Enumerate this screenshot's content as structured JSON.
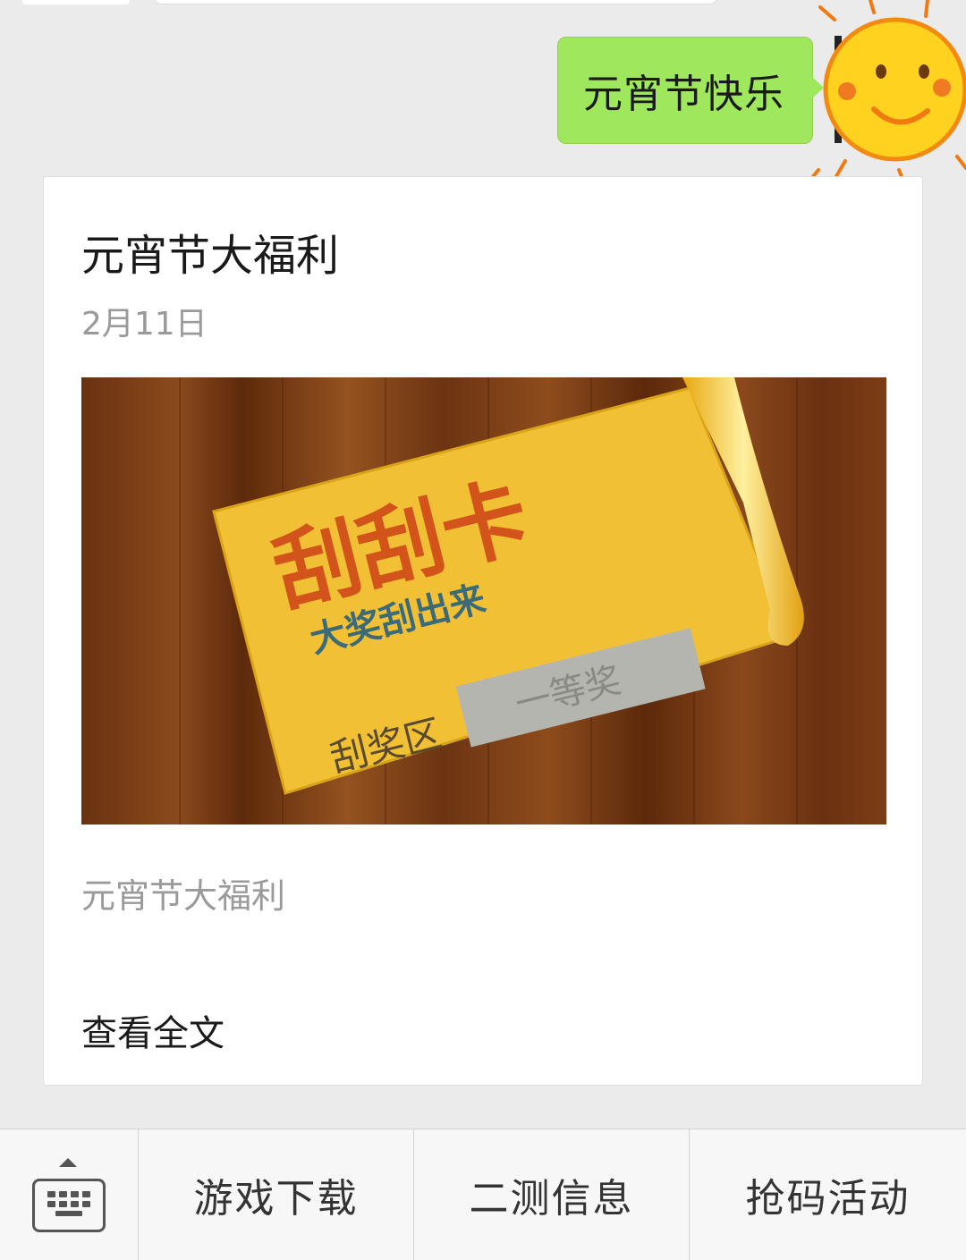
{
  "chat": {
    "outgoing_message": "元宵节快乐"
  },
  "article": {
    "title": "元宵节大福利",
    "date": "2月11日",
    "cover": {
      "headline": "刮刮卡",
      "subheadline": "大奖刮出来",
      "area_label": "刮奖区",
      "scratched_text": "一等奖"
    },
    "summary": "元宵节大福利",
    "read_more": "查看全文"
  },
  "menu": {
    "keyboard_icon": "keyboard-icon",
    "items": [
      {
        "label": "游戏下载"
      },
      {
        "label": "二测信息"
      },
      {
        "label": "抢码活动"
      }
    ]
  },
  "colors": {
    "chat_bg": "#ebebeb",
    "outgoing_bubble": "#9fe75d",
    "card_bg": "#ffffff",
    "muted_text": "#9a9a9a",
    "scratch_card": "#f2c035",
    "wood": "#7a3d12"
  }
}
